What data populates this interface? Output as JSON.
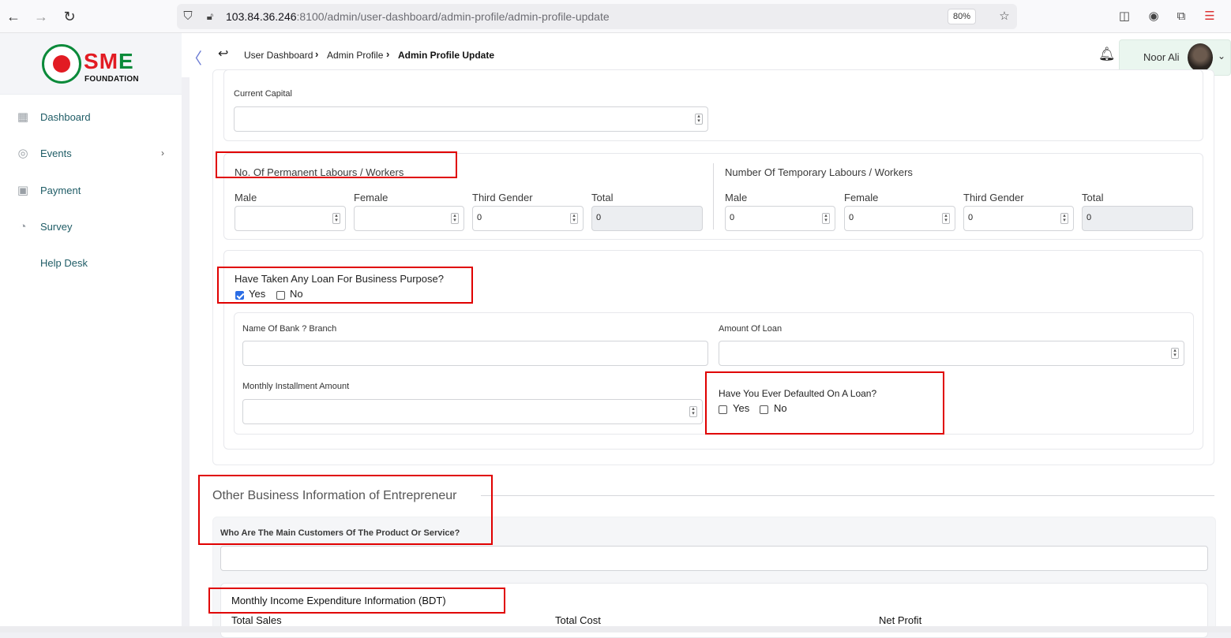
{
  "browser": {
    "url_host": "103.84.36.246",
    "url_rest": ":8100/admin/user-dashboard/admin-profile/admin-profile-update",
    "zoom": "80%",
    "icons": [
      "back-arrow-icon",
      "forward-arrow-icon",
      "reload-icon",
      "shield-icon",
      "lock-icon",
      "star-icon",
      "pocket-icon",
      "account-icon",
      "extensions-icon",
      "menu-icon"
    ]
  },
  "sidebar": {
    "logo_text_a": "S",
    "logo_text_b": "M",
    "logo_text_c": "E",
    "logo_sub": "FOUNDATION",
    "items": [
      {
        "label": "Dashboard",
        "icon": "grid-icon"
      },
      {
        "label": "Events",
        "icon": "events-icon",
        "chevron": "›"
      },
      {
        "label": "Payment",
        "icon": "payment-icon"
      },
      {
        "label": "Survey",
        "icon": "pie-chart-icon"
      },
      {
        "label": "Help Desk",
        "icon": ""
      }
    ]
  },
  "header": {
    "breadcrumbs": [
      "User Dashboard",
      "Admin Profile",
      "Admin Profile Update"
    ],
    "user_name": "Noor Ali"
  },
  "form": {
    "current_capital_label": "Current Capital",
    "permanent_title": "No. Of Permanent Labours / Workers",
    "temporary_title": "Number Of Temporary Labours / Workers",
    "col_male": "Male",
    "col_female": "Female",
    "col_third": "Third Gender",
    "col_total": "Total",
    "permanent_values": {
      "male": "",
      "female": "",
      "third": "0",
      "total": "0"
    },
    "temporary_values": {
      "male": "0",
      "female": "0",
      "third": "0",
      "total": "0"
    },
    "loan_question": "Have Taken Any Loan For Business Purpose?",
    "yes": "Yes",
    "no": "No",
    "loan_yes_checked": true,
    "bank_label": "Name Of Bank ? Branch",
    "amount_label": "Amount Of Loan",
    "installment_label": "Monthly Installment Amount",
    "default_question": "Have You Ever Defaulted On A Loan?",
    "other_section_title": "Other Business Information of Entrepreneur",
    "customers_label": "Who Are The Main Customers Of The Product Or Service?",
    "income_title": "Monthly Income Expenditure Information (BDT)",
    "total_sales": "Total Sales",
    "total_cost": "Total Cost",
    "net_profit": "Net Profit"
  }
}
